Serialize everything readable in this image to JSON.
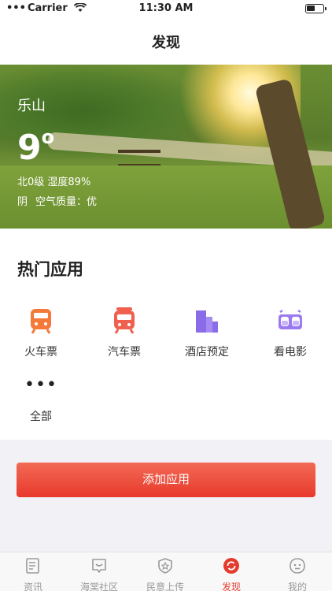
{
  "status_bar": {
    "carrier": "Carrier",
    "time": "11:30 AM"
  },
  "nav": {
    "title": "发现"
  },
  "weather": {
    "city": "乐山",
    "temperature": "9",
    "degree": "o",
    "wind_humidity": "北0级 湿度89%",
    "condition": "阴",
    "air_quality": "空气质量：优"
  },
  "hot_apps": {
    "title": "热门应用",
    "items": [
      {
        "label": "火车票",
        "icon": "train-icon",
        "color": "#f47a3a"
      },
      {
        "label": "汽车票",
        "icon": "bus-icon",
        "color": "#f0604f"
      },
      {
        "label": "酒店预定",
        "icon": "hotel-icon",
        "color": "#8a6be8"
      },
      {
        "label": "看电影",
        "icon": "glasses-icon",
        "color": "#9b7af0"
      }
    ],
    "more": {
      "dots": "•••",
      "label": "全部"
    }
  },
  "add_button": {
    "label": "添加应用"
  },
  "tab_bar": {
    "items": [
      {
        "label": "资讯",
        "icon": "news-icon"
      },
      {
        "label": "海棠社区",
        "icon": "community-icon"
      },
      {
        "label": "民意上传",
        "icon": "upload-icon"
      },
      {
        "label": "发现",
        "icon": "discover-icon",
        "active": true
      },
      {
        "label": "我的",
        "icon": "profile-icon"
      }
    ]
  },
  "colors": {
    "accent": "#e8392c",
    "tab_inactive": "#9a9a9a"
  }
}
